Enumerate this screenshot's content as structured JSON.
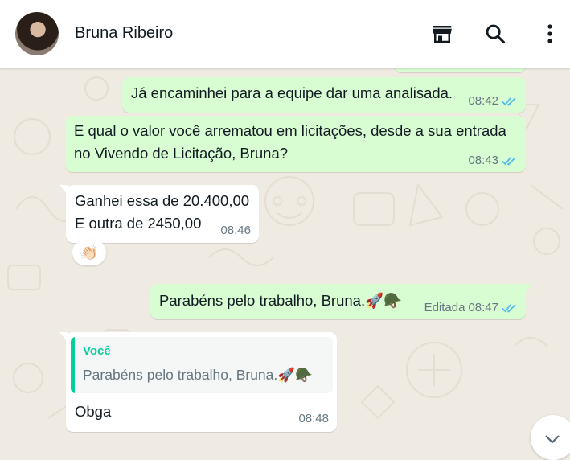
{
  "header": {
    "contact_name": "Bruna Ribeiro",
    "icons": [
      "store-icon",
      "search-icon",
      "kebab-menu-icon"
    ]
  },
  "messages": [
    {
      "direction": "out",
      "text": "Já encaminhei para a equipe dar uma analisada.",
      "time": "08:42",
      "status": "read"
    },
    {
      "direction": "out",
      "lines": [
        "E qual o valor você arrematou em licitações, desde a sua entrada",
        "no Vivendo de Licitação, Bruna?"
      ],
      "time": "08:43",
      "status": "read"
    },
    {
      "direction": "in",
      "lines": [
        "Ganhei essa de 20.400,00",
        "E outra de 2450,00"
      ],
      "time": "08:46",
      "reaction": "👏🏻"
    },
    {
      "direction": "out",
      "text": "Parabéns pelo trabalho, Bruna.🚀🪖",
      "edited": "Editada",
      "time": "08:47",
      "status": "read"
    },
    {
      "direction": "in",
      "quote": {
        "author": "Você",
        "text": "Parabéns pelo trabalho, Bruna.🚀🪖"
      },
      "text": "Obga",
      "time": "08:48"
    }
  ],
  "colors": {
    "outgoing_bubble": "#d9fdd3",
    "incoming_bubble": "#ffffff",
    "wallpaper": "#efeae2",
    "read_ticks": "#53bdeb",
    "quote_accent": "#06cf9c"
  }
}
